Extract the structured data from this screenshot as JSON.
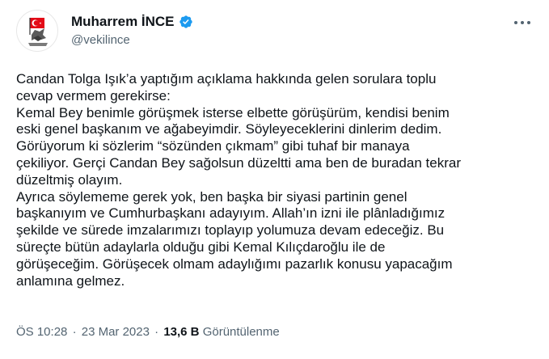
{
  "author": {
    "display_name": "Muharrem İNCE",
    "handle": "@vekilince",
    "verified": true,
    "badge_color": "#1d9bf0"
  },
  "tweet": {
    "lines": [
      "Candan Tolga Işık’a yaptığım açıklama hakkında gelen sorulara toplu",
      "cevap vermem gerekirse:",
      "Kemal Bey benimle görüşmek isterse elbette görüşürüm, kendisi benim",
      "eski genel başkanım ve ağabeyimdir. Söyleyeceklerini dinlerim dedim.",
      "Görüyorum ki sözlerim “sözünden çıkmam” gibi tuhaf bir manaya",
      "çekiliyor. Gerçi Candan Bey sağolsun düzeltti ama ben de buradan tekrar",
      "düzeltmiş olayım.",
      "Ayrıca söylememe gerek yok, ben başka bir siyasi partinin genel",
      "başkanıyım ve Cumhurbaşkanı adayıyım. Allah’ın izni ile plânladığımız",
      "şekilde ve sürede imzalarımızı toplayıp yolumuza devam edeceğiz. Bu",
      "süreçte bütün adaylarla olduğu gibi Kemal Kılıçdaroğlu ile de",
      "görüşeceğim. Görüşecek olmam adaylığımı pazarlık konusu yapacağım",
      "anlamına gelmez."
    ]
  },
  "meta": {
    "time": "ÖS 10:28",
    "separator": "·",
    "date": "23 Mar 2023",
    "views_count": "13,6 B",
    "views_label": "Görüntülenme"
  },
  "icons": {
    "more": "more-options-icon",
    "verified": "verified-badge-icon"
  }
}
